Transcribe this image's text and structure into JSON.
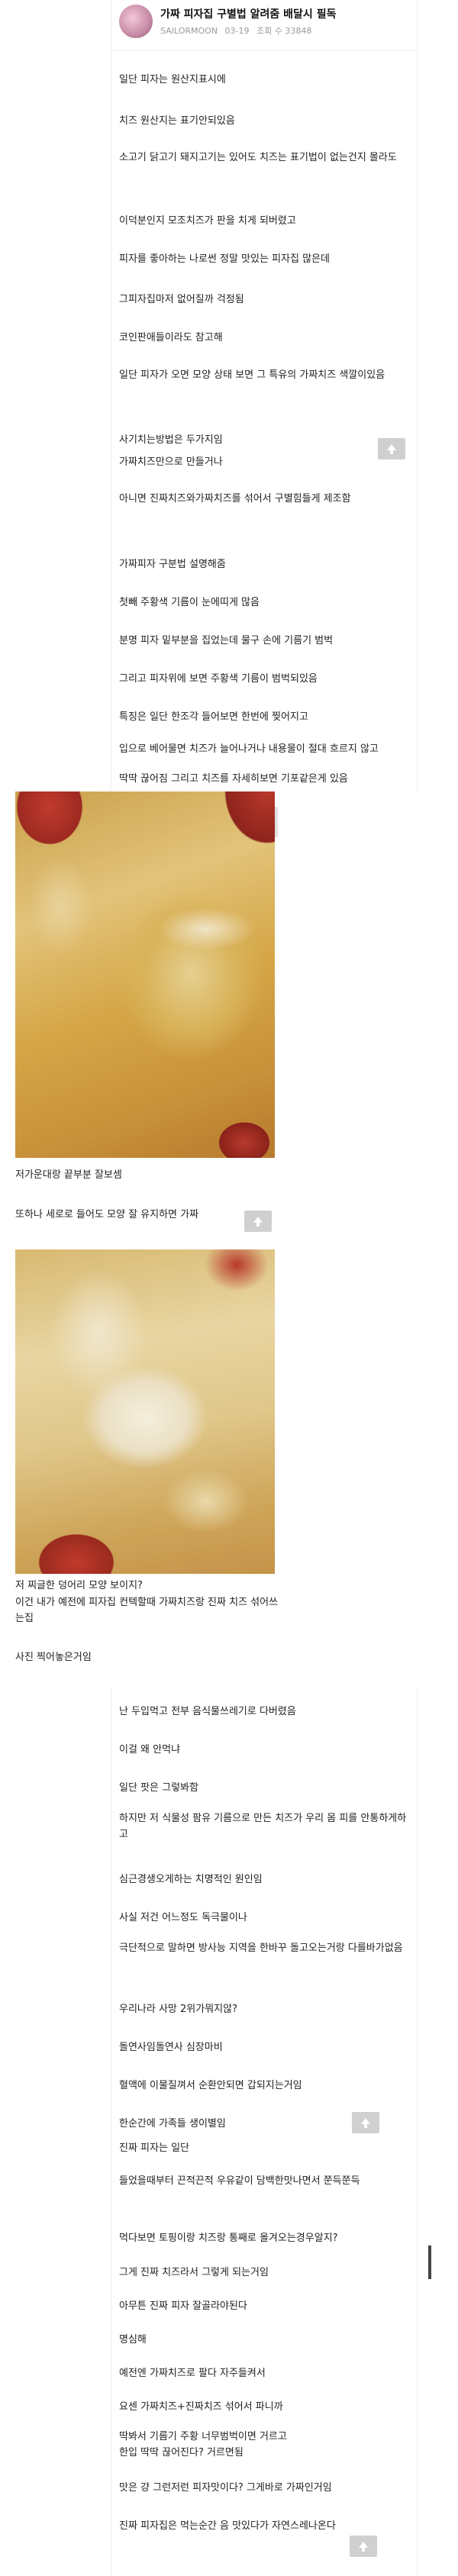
{
  "header": {
    "title": "가짜 피자집 구별법 알려줌 배달시 필독",
    "author": "SAILORMOON",
    "date": "03-19",
    "views": "조회 수 33848"
  },
  "top_lines": [
    "일단 피자는 원산지표시에",
    "치즈 원산지는 표기안되있음",
    "소고기 닭고기 돼지고기는 있어도 치즈는 표기법이 없는건지 몰라도",
    "이덕분인지 모조치즈가 판을 치게 되버렸고",
    "피자를 좋아하는 나로썬 정말 맛있는 피자집 많은데",
    "그피자집마저 없어질까 걱정됨",
    "코인판애들이라도 참고해",
    "일단 피자가 오면 모양 상태 보면 그 특유의 가짜치즈 색깔이있음",
    "사기치는방법은 두가지임",
    "가짜치즈만으로 만들거나",
    "아니면 진짜치즈와가짜치즈를 섞어서 구별힘들게 제조함",
    "가짜피자 구분법 설명해줌",
    "첫빼 주황색 기름이 눈에띠게 많음",
    "분명 피자 밑부분을 집었는데 물구 손에 기름기 범벅",
    "그리고 피자위에 보면 주황색 기름이 범벅되있음",
    "특징은 일단 한조각 들어보면 한번에 찢어지고",
    "입으로 베어물면 치즈가 늘어나거나 내용물이 절대 흐르지 않고",
    "딱딱 끊어짐 그리고 치즈를 자세히보면 기포같은게 있음"
  ],
  "mid_lines": [
    "저가운대랑 끝부분 잘보셈",
    "또하나 세로로 들어도 모양 잘 유지하면 가짜",
    "저 찌글한 덩어리 모양 보이지?",
    "이건 내가 예전에 피자집 컨텍할때 가짜치즈랑 진짜 치즈 섞어쓰는집",
    "사진 찍어놓은거임"
  ],
  "bottom_lines": [
    "난 두입먹고 전부 음식물쓰레기로 다버렸음",
    "이걸 왜 안먹냐",
    "일단 팟은 그렇봐함",
    "하지만 저 식물성 팜유 기름으로 만든 치즈가 우리 몸 피를 안통하게하고",
    "심근경생오게하는 치명적인 원인임",
    "사실 저건 어느정도 독극물이나",
    "극단적으로 말하면 방사능 지역을 한바꾸 돌고오는거랑 다를바가없음",
    "우리나라 사망 2위가뭐지않?",
    "돌연사임돌연사 심장마비",
    "혈액에 이물질껴서 순환안되면 갑되지는거임",
    "한순간에 가족들 생이별임",
    "진짜 피자는 일단",
    "들었을때부터 끈적끈적 우유같이 담백한맛나면서 쭌득쭌득",
    "먹다보면 토핑이랑 치즈랑 통째로 올겨오는경우알지?",
    "그게 진짜 치즈라서 그렇게 되는거임",
    "아무튼 진짜 피자 잘골라야된다",
    "명심해",
    "예전엔 가짜치즈로 팔다 자주들켜서",
    "요센 가짜치즈+진짜치즈 섞어서 파니까",
    "딱봐서 기름기 주황 너무범벅이면 거르고",
    "한입 딱딱 끊어진다? 거르면됨",
    "맛은 걍 그런저런 피자맛이다? 그게바로 가짜인거임",
    "진짜 피자집은 먹는순간 음 맛있다가 자연스레나온다"
  ],
  "colors": {
    "accent_button": "#d0d0d0",
    "text": "#222222",
    "meta": "#9a9a9a"
  },
  "icons": [
    "up-arrow-icon"
  ]
}
